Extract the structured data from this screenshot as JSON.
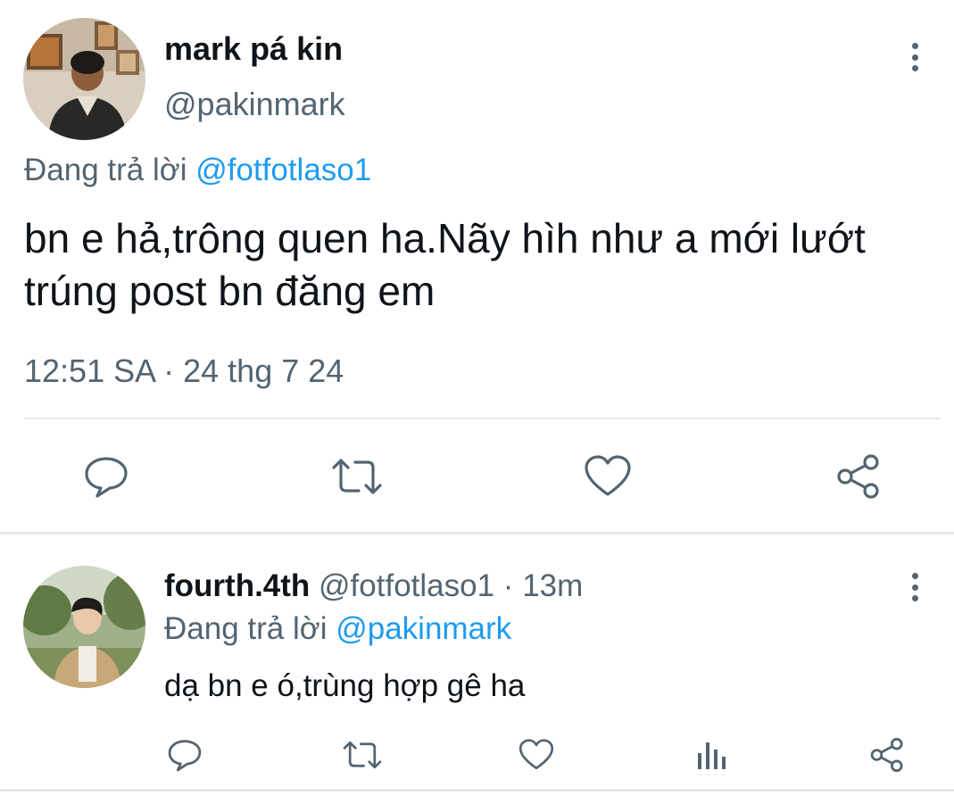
{
  "main_tweet": {
    "display_name": "mark pá kin",
    "handle": "@pakinmark",
    "replying_prefix": "Đang trả lời",
    "replying_to": "@fotfotlaso1",
    "text": "bn e hả,trông quen ha.Nãy hìh như a mới lướt trúng post bn đăng em",
    "timestamp": "12:51 SA · 24 thg 7 24"
  },
  "reply_tweet": {
    "display_name": "fourth.4th",
    "handle": "@fotfotlaso1",
    "separator": "·",
    "time_ago": "13m",
    "replying_prefix": "Đang trả lời",
    "replying_to": "@pakinmark",
    "text": "dạ bn e ó,trùng hợp gê ha"
  },
  "icons": {
    "main_actions": [
      "comment-icon",
      "retweet-icon",
      "heart-icon",
      "share-icon"
    ],
    "reply_actions": [
      "comment-icon",
      "retweet-icon",
      "heart-icon",
      "analytics-icon",
      "share-icon"
    ],
    "more": "more-vertical-icon"
  },
  "colors": {
    "link": "#1d9bf0",
    "secondary_text": "#536471",
    "divider": "#e6e9eb"
  }
}
